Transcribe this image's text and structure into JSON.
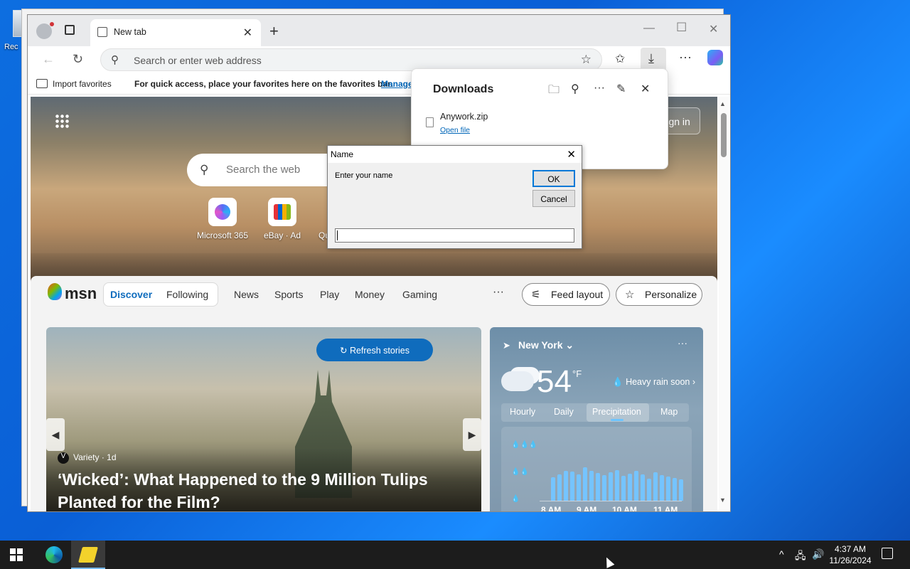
{
  "desktop": {
    "recycle_bin_label": "Rec"
  },
  "browser": {
    "tab_title": "New tab",
    "address_placeholder": "Search or enter web address",
    "favorites_bar": {
      "import_label": "Import favorites",
      "message": "For quick access, place your favorites here on the favorites bar.",
      "manage_label": "Manage"
    }
  },
  "newtab": {
    "search_placeholder": "Search the web",
    "sign_in_label": "Sign in",
    "quick_links": [
      {
        "label": "Microsoft 365"
      },
      {
        "label": "eBay · Ad"
      },
      {
        "label": "Qu"
      }
    ]
  },
  "msn": {
    "logo_text": "msn",
    "nav": [
      "Discover",
      "Following",
      "News",
      "Sports",
      "Play",
      "Money",
      "Gaming"
    ],
    "more_label": "···",
    "feed_layout_label": "Feed layout",
    "personalize_label": "Personalize",
    "refresh_label": "Refresh stories",
    "story": {
      "source": "Variety",
      "age": "· 1d",
      "headline": "‘Wicked’: What Happened to the 9 Million Tulips Planted for the Film?"
    },
    "weather": {
      "location": "New York",
      "temperature": "54",
      "unit": "°F",
      "alert": "Heavy rain soon",
      "tabs": [
        "Hourly",
        "Daily",
        "Precipitation",
        "Map"
      ],
      "active_tab": "Precipitation",
      "chart_x_labels": [
        "8 AM",
        "9 AM",
        "10 AM",
        "11 AM"
      ],
      "precip_levels": [
        0.55,
        0.62,
        0.7,
        0.68,
        0.62,
        0.78,
        0.7,
        0.65,
        0.6,
        0.66,
        0.72,
        0.58,
        0.64,
        0.7,
        0.62,
        0.52,
        0.66,
        0.6,
        0.56,
        0.54,
        0.5
      ]
    }
  },
  "downloads": {
    "title": "Downloads",
    "file_name": "Anywork.zip",
    "open_file_label": "Open file"
  },
  "dialog": {
    "title": "Name",
    "prompt": "Enter your name",
    "ok_label": "OK",
    "cancel_label": "Cancel",
    "input_value": ""
  },
  "taskbar": {
    "time": "4:37 AM",
    "date": "11/26/2024"
  }
}
